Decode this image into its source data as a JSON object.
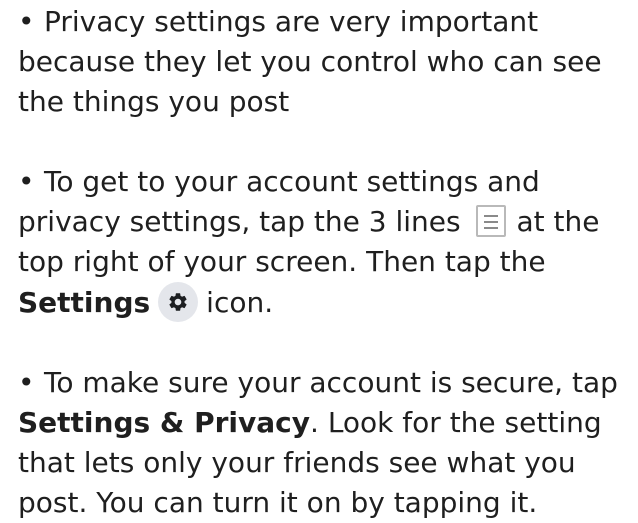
{
  "bullet": "•",
  "tips": [
    {
      "text": "Privacy settings are very important because they let you control who can see the things you post"
    },
    {
      "part1": "To get to your account settings and privacy settings, tap the 3 lines",
      "part2": "at the top right of your screen. Then tap the",
      "bold": "Settings",
      "part3": "icon."
    },
    {
      "bold": "Settings & Privacy",
      "part1": "To make sure your account is secure, tap",
      "part2": ". Look for the setting that lets only your friends see what you post. You can turn it on by tapping it."
    }
  ],
  "icons": {
    "menu": "menu-icon",
    "settings": "gear-icon"
  },
  "colors": {
    "text": "#1f1f1f",
    "gear_bg": "#e4e6eb",
    "menu_border": "#b9b9b9"
  }
}
